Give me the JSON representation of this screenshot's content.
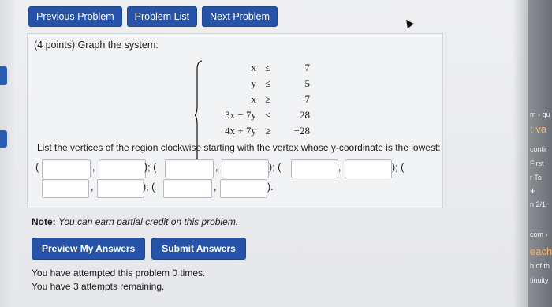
{
  "toolbar": {
    "previous_label": "Previous Problem",
    "list_label": "Problem List",
    "next_label": "Next Problem"
  },
  "problem": {
    "title": "(4 points) Graph the system:",
    "system": [
      {
        "lhs": "x",
        "rel": "≤",
        "rhs": "7"
      },
      {
        "lhs": "y",
        "rel": "≤",
        "rhs": "5"
      },
      {
        "lhs": "x",
        "rel": "≥",
        "rhs": "−7"
      },
      {
        "lhs": "3x − 7y",
        "rel": "≤",
        "rhs": "28"
      },
      {
        "lhs": "4x + 7y",
        "rel": "≥",
        "rhs": "−28"
      }
    ],
    "instructions": "List the vertices of the region clockwise starting with the vertex whose y-coordinate is the lowest:",
    "punct": {
      "open": "(",
      "comma": ",",
      "sep": "); (",
      "close": ")."
    },
    "answers": [
      "",
      "",
      "",
      "",
      "",
      "",
      "",
      "",
      "",
      ""
    ]
  },
  "note": {
    "label": "Note:",
    "text": "You can earn partial credit on this problem."
  },
  "actions": {
    "preview_label": "Preview My Answers",
    "submit_label": "Submit Answers"
  },
  "attempts": {
    "line1": "You have attempted this problem 0 times.",
    "line2": "You have 3 attempts remaining."
  },
  "edge": {
    "t1": "m › qu",
    "t2": "t va",
    "t3": "contir",
    "t4": "First",
    "t5": "r To",
    "t6": "+",
    "t7": "n 2/1",
    "t8": "com ›",
    "t9": "each",
    "t10": "h of th",
    "t11": "tinuity"
  },
  "colors": {
    "button_bg": "#2653a8",
    "panel_bg": "#f2f3f5",
    "page_bg": "#e9eaec"
  }
}
